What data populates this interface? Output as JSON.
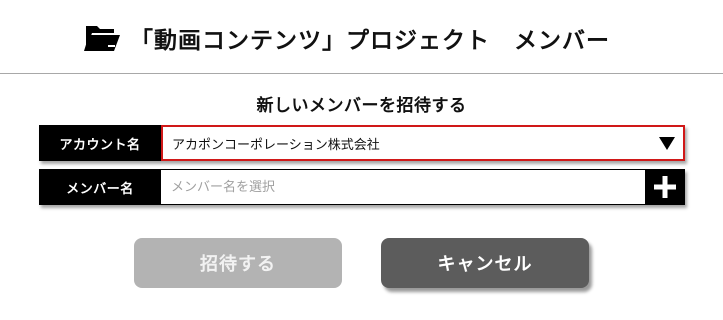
{
  "header": {
    "title": "「動画コンテンツ」プロジェクト　メンバー",
    "icon": "folder-open-icon"
  },
  "invite": {
    "heading": "新しいメンバーを招待する",
    "account": {
      "label": "アカウント名",
      "selected_value": "アカポンコーポレーション株式会社"
    },
    "member": {
      "label": "メンバー名",
      "value": "",
      "placeholder": "メンバー名を選択",
      "add_icon": "plus-icon"
    }
  },
  "actions": {
    "invite_label": "招待する",
    "cancel_label": "キャンセル"
  },
  "colors": {
    "label_background": "#000000",
    "select_border": "#d01818",
    "invite_button_disabled": "#b3b3b3",
    "cancel_button": "#5c5c5c"
  }
}
